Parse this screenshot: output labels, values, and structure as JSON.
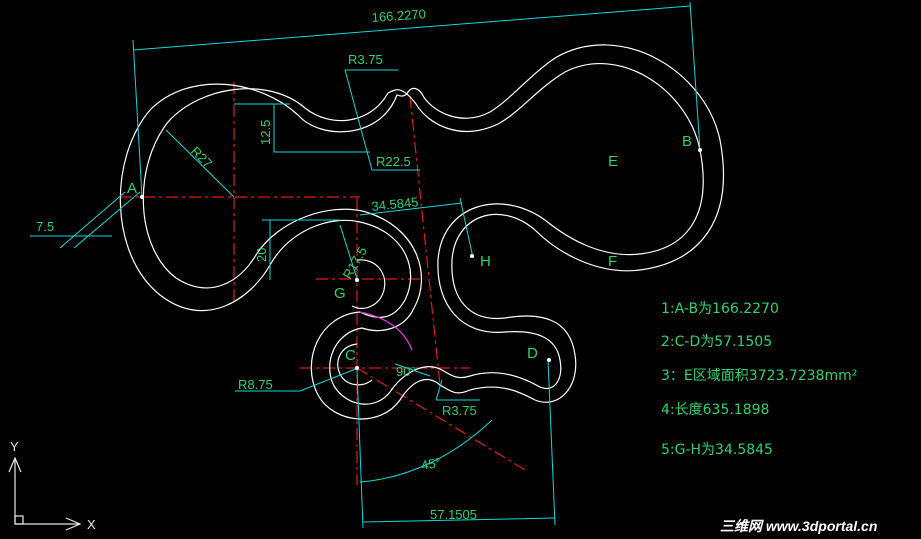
{
  "dimensions": {
    "d_166": "166.2270",
    "r375_top": "R3.75",
    "r125": "12.5",
    "r27": "R27",
    "r225": "R22.5",
    "d75": "7.5",
    "d345845": "34.5845",
    "d20": "20",
    "r175": "R17.5",
    "r875": "R8.75",
    "a90": "90°",
    "r375_bot": "R3.75",
    "a45": "45°",
    "d571505": "57.1505"
  },
  "points": {
    "A": "A",
    "B": "B",
    "C": "C",
    "D": "D",
    "E": "E",
    "F": "F",
    "G": "G",
    "H": "H"
  },
  "notes": [
    "1:A-B为166.2270",
    "2:C-D为57.1505",
    "3：E区域面积3723.7238mm²",
    "4:长度635.1898",
    "5:G-H为34.5845"
  ],
  "axes": {
    "x": "X",
    "y": "Y"
  },
  "watermark": "三维网 www.3dportal.cn",
  "colors": {
    "background": "#000000",
    "outline": "#ffffff",
    "dimension_lines": "#12d8d8",
    "center_lines": "#e01a1a",
    "text": "#2ad36f"
  }
}
